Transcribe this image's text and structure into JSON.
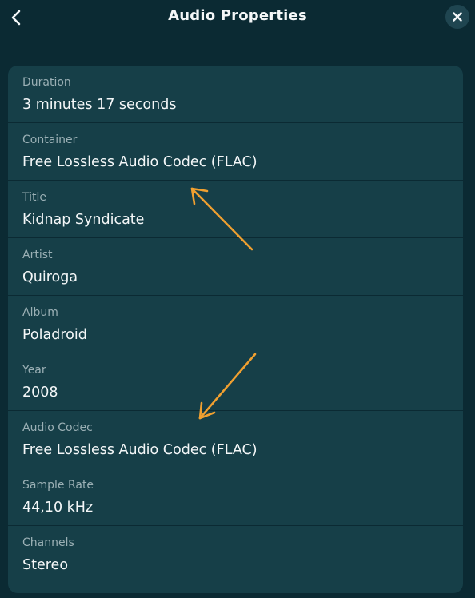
{
  "header": {
    "title": "Audio Properties",
    "back_icon": "chevron-left-icon",
    "close_icon": "close-icon"
  },
  "properties": [
    {
      "label": "Duration",
      "value": "3 minutes 17 seconds"
    },
    {
      "label": "Container",
      "value": "Free Lossless Audio Codec (FLAC)"
    },
    {
      "label": "Title",
      "value": "Kidnap Syndicate"
    },
    {
      "label": "Artist",
      "value": "Quiroga"
    },
    {
      "label": "Album",
      "value": "Poladroid"
    },
    {
      "label": "Year",
      "value": "2008"
    },
    {
      "label": "Audio Codec",
      "value": "Free Lossless Audio Codec (FLAC)"
    },
    {
      "label": "Sample Rate",
      "value": "44,10 kHz"
    },
    {
      "label": "Channels",
      "value": "Stereo"
    }
  ],
  "colors": {
    "background": "#0b2a33",
    "panel": "#163f48",
    "annotation_arrow": "#f0a030"
  }
}
